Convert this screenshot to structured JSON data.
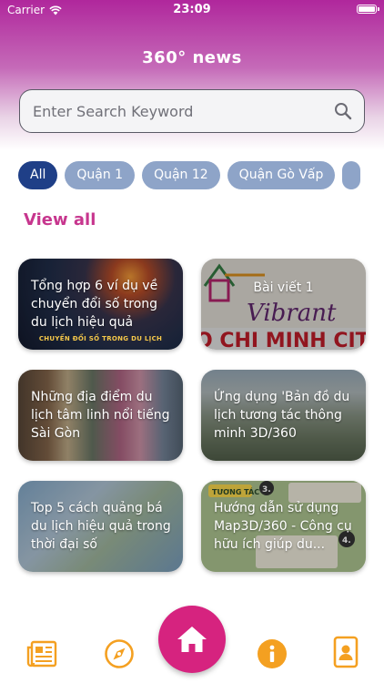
{
  "status_bar": {
    "carrier": "Carrier",
    "time": "23:09"
  },
  "header": {
    "title": "360° news"
  },
  "search": {
    "placeholder": "Enter Search Keyword",
    "icon": "search-icon"
  },
  "filters": [
    {
      "label": "All",
      "selected": true
    },
    {
      "label": "Quận 1",
      "selected": false
    },
    {
      "label": "Quận 12",
      "selected": false
    },
    {
      "label": "Quận Gò Vấp",
      "selected": false
    }
  ],
  "view_all_label": "View all",
  "articles": [
    {
      "title": "Tổng hợp 6 ví dụ về chuyển đổi số trong du lịch hiệu quả",
      "caption": "CHUYỂN ĐỔI SỐ TRONG DU LỊCH"
    },
    {
      "title": "Bài viết 1",
      "image_text_1": "Vibrant",
      "image_text_2": "O CHI MINH CIT"
    },
    {
      "title": "Những địa điểm du lịch tâm linh nổi tiếng Sài Gòn"
    },
    {
      "title": "Ứng dụng 'Bản đồ du lịch tương tác thông minh 3D/360"
    },
    {
      "title": "Top 5 cách quảng bá du lịch hiệu quả trong thời đại số"
    },
    {
      "title": "Hướng dẫn sử dụng Map3D/360 - Công cụ hữu ích giúp du...",
      "image_text_1": "TƯƠNG TÁC",
      "image_text_2": "3.",
      "image_text_3": "4."
    }
  ],
  "bottom_nav": [
    {
      "name": "news",
      "icon": "newspaper-icon"
    },
    {
      "name": "explore",
      "icon": "compass-icon"
    },
    {
      "name": "home",
      "icon": "home-icon"
    },
    {
      "name": "info",
      "icon": "info-icon"
    },
    {
      "name": "contact",
      "icon": "contact-card-icon"
    }
  ],
  "colors": {
    "brand": "#b0279c",
    "home_button": "#d6237f",
    "chip_active": "#1f3f87",
    "chip_inactive": "#8ea4c8",
    "nav_icon": "#f4a021",
    "view_all": "#c7368e"
  }
}
